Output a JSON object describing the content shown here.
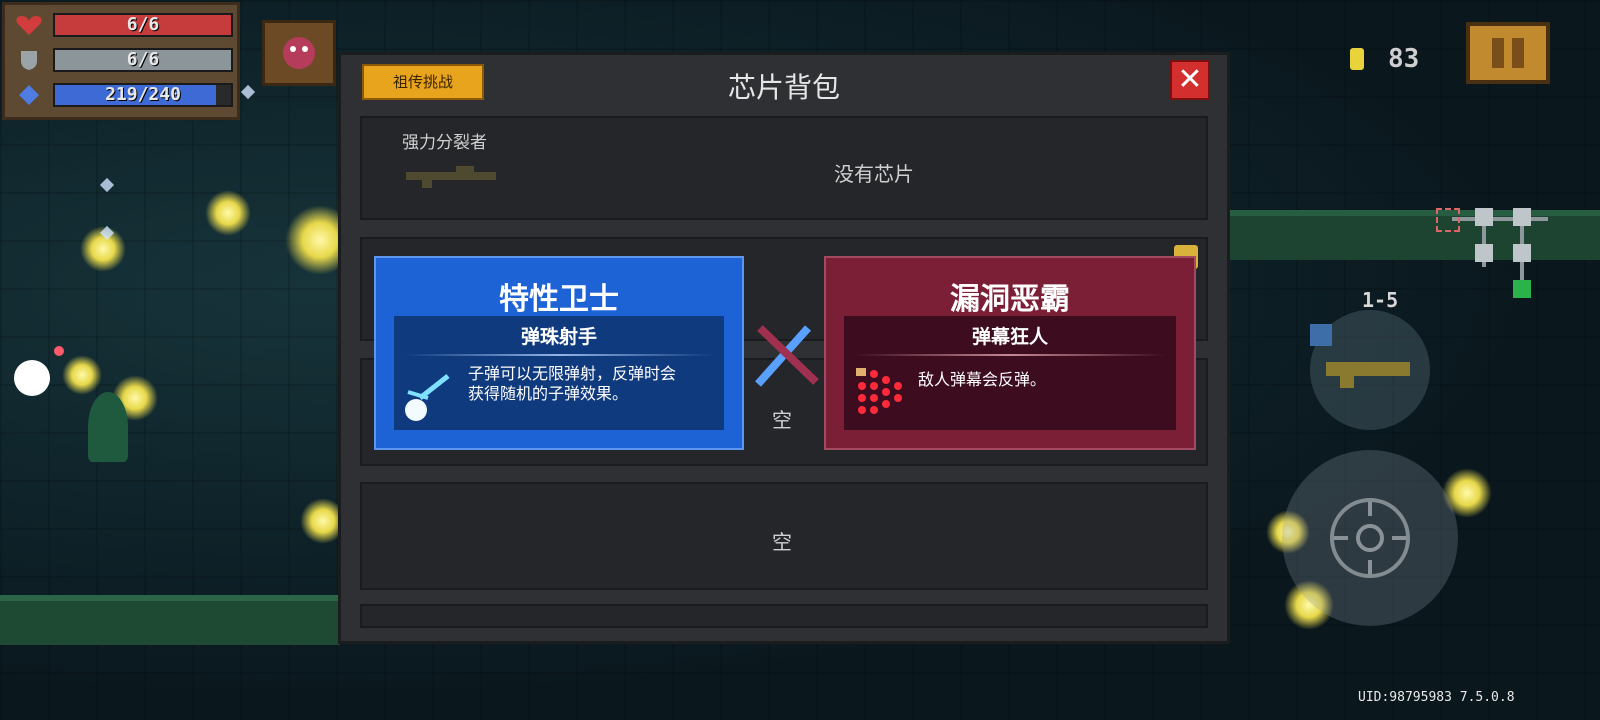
{
  "hud": {
    "health": {
      "value": "6/6",
      "fill": 1.0,
      "color": "#c63c3c"
    },
    "armor": {
      "value": "6/6",
      "fill": 1.0,
      "color": "#8b959a"
    },
    "energy": {
      "value": "219/240",
      "fill": 0.9125,
      "color": "#3e6ad6"
    }
  },
  "coins": "83",
  "level": "1-5",
  "uid": "UID:98795983 7.5.0.8",
  "panel": {
    "title": "芯片背包",
    "legend_button": "祖传挑战",
    "close_label": "✕",
    "slots": [
      {
        "weapon_name": "强力分裂者",
        "status": "没有芯片"
      },
      {
        "status": "空"
      },
      {
        "status": "空"
      }
    ]
  },
  "compare": {
    "left": {
      "title": "特性卫士",
      "subtitle": "弹珠射手",
      "description": "子弹可以无限弹射，反弹时会获得随机的子弹效果。",
      "color": "#1e63d6"
    },
    "right": {
      "title": "漏洞恶霸",
      "subtitle": "弹幕狂人",
      "description": "敌人弹幕会反弹。",
      "color": "#7a1f35"
    }
  }
}
